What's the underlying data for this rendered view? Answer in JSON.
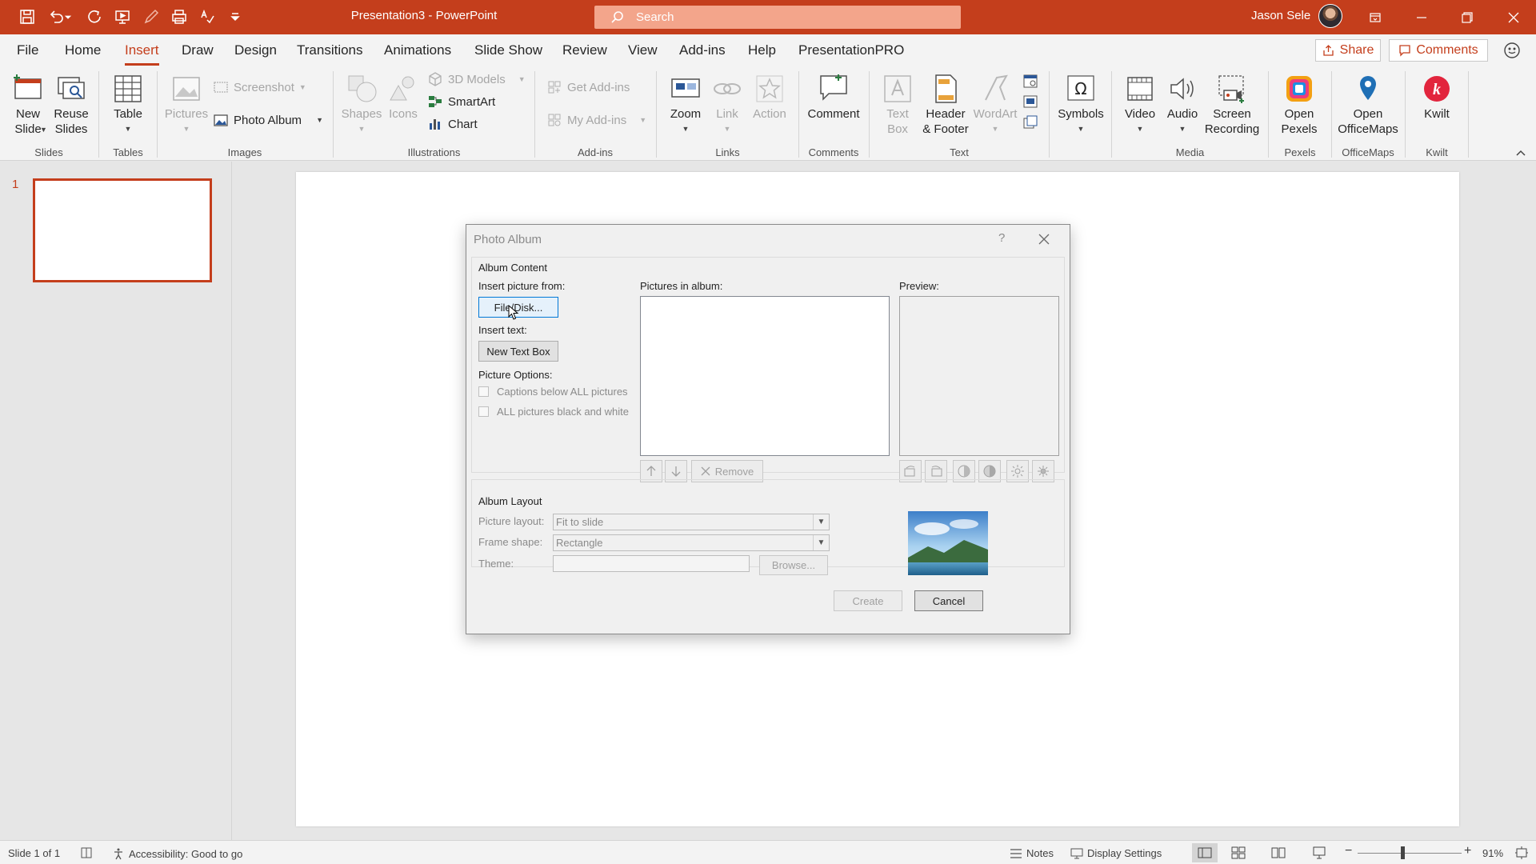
{
  "titlebar": {
    "doc_title": "Presentation3  -  PowerPoint",
    "search_placeholder": "Search",
    "user_name": "Jason Sele",
    "accent_color": "#c43e1c"
  },
  "menu": {
    "tabs": [
      "File",
      "Home",
      "Insert",
      "Draw",
      "Design",
      "Transitions",
      "Animations",
      "Slide Show",
      "Review",
      "View",
      "Add-ins",
      "Help",
      "PresentationPRO"
    ],
    "active_tab": "Insert",
    "share_label": "Share",
    "comments_label": "Comments"
  },
  "ribbon": {
    "slides": {
      "new_slide": "New\nSlide",
      "reuse_slides": "Reuse\nSlides",
      "group": "Slides"
    },
    "tables": {
      "table": "Table",
      "group": "Tables"
    },
    "images": {
      "pictures": "Pictures",
      "screenshot": "Screenshot",
      "photo_album": "Photo Album",
      "group": "Images"
    },
    "illustrations": {
      "shapes": "Shapes",
      "icons": "Icons",
      "models3d": "3D Models",
      "smartart": "SmartArt",
      "chart": "Chart",
      "group": "Illustrations"
    },
    "addins": {
      "get_addins": "Get Add-ins",
      "my_addins": "My Add-ins",
      "group": "Add-ins"
    },
    "links": {
      "zoom": "Zoom",
      "link": "Link",
      "action": "Action",
      "group": "Links"
    },
    "comments": {
      "comment": "Comment",
      "group": "Comments"
    },
    "text": {
      "text_box": "Text\nBox",
      "header_footer": "Header\n& Footer",
      "wordart": "WordArt",
      "group": "Text"
    },
    "symbols": {
      "symbols": "Symbols"
    },
    "media": {
      "video": "Video",
      "audio": "Audio",
      "screen_recording": "Screen\nRecording",
      "group": "Media"
    },
    "pexels": {
      "open_pexels": "Open\nPexels",
      "group": "Pexels"
    },
    "officemaps": {
      "open_officemaps": "Open\nOfficeMaps",
      "group": "OfficeMaps"
    },
    "kwilt": {
      "kwilt": "Kwilt",
      "group": "Kwilt"
    }
  },
  "thumbnails": {
    "slide_number": "1"
  },
  "dialog": {
    "title": "Photo Album",
    "help": "?",
    "album_content": "Album Content",
    "insert_picture_from": "Insert picture from:",
    "file_disk": "File/Disk...",
    "insert_text": "Insert text:",
    "new_text_box": "New Text Box",
    "picture_options": "Picture Options:",
    "captions_below": "Captions below ALL pictures",
    "black_white": "ALL pictures black and white",
    "pictures_in_album": "Pictures in album:",
    "preview": "Preview:",
    "remove": "Remove",
    "album_layout": "Album Layout",
    "picture_layout_label": "Picture layout:",
    "picture_layout_value": "Fit to slide",
    "frame_shape_label": "Frame shape:",
    "frame_shape_value": "Rectangle",
    "theme_label": "Theme:",
    "theme_value": "",
    "browse": "Browse...",
    "create": "Create",
    "cancel": "Cancel"
  },
  "status": {
    "slide_info": "Slide 1 of 1",
    "accessibility": "Accessibility: Good to go",
    "notes": "Notes",
    "display_settings": "Display Settings",
    "zoom_level": "91%"
  }
}
